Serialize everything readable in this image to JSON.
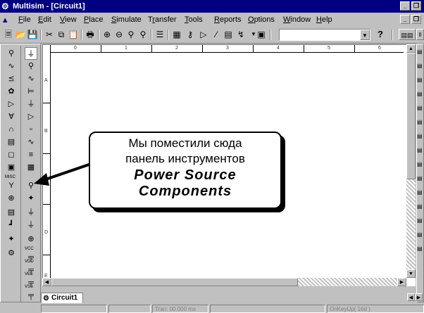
{
  "window": {
    "title": "Multisim - [Circuit1]",
    "app_icon": "multisim-icon",
    "controls": {
      "minimize": "_",
      "restore": "❐",
      "doc_minimize": "_",
      "doc_restore": "❐"
    }
  },
  "menu": {
    "items": [
      {
        "label": "File",
        "accel": "F"
      },
      {
        "label": "Edit",
        "accel": "E"
      },
      {
        "label": "View",
        "accel": "V"
      },
      {
        "label": "Place",
        "accel": "P"
      },
      {
        "label": "Simulate",
        "accel": "S"
      },
      {
        "label": "Transfer",
        "accel": "r"
      },
      {
        "label": "Tools",
        "accel": "T"
      },
      {
        "label": "Reports",
        "accel": "R"
      },
      {
        "label": "Options",
        "accel": "O"
      },
      {
        "label": "Window",
        "accel": "W"
      },
      {
        "label": "Help",
        "accel": "H"
      }
    ]
  },
  "toolbar": {
    "combo_value": "",
    "help_glyph": "?",
    "icons": [
      "new-icon",
      "open-icon",
      "save-icon",
      "cut-icon",
      "copy-icon",
      "paste-icon",
      "print-icon",
      "zoom-in-icon",
      "zoom-out-icon",
      "zoom-area-icon",
      "zoom-fit-icon",
      "hierarchy-icon",
      "spreadsheet-icon",
      "database-icon",
      "component-wizard-icon",
      "postprocessor-icon",
      "grapher-icon",
      "instrument-icon",
      "list-icon"
    ]
  },
  "ruler": {
    "columns": [
      "0",
      "1",
      "2",
      "3",
      "4",
      "5",
      "6"
    ],
    "rows": [
      "A",
      "B",
      "C",
      "D",
      "E"
    ]
  },
  "left_toolbar": {
    "col1": [
      "source-icon",
      "basic-icon",
      "diode-icon",
      "transistor-icon",
      "analog-icon",
      "ttl-icon",
      "cmos-icon",
      "mcu-icon",
      "misc-digital-icon",
      "mixed-icon",
      "indicator-icon",
      "misc-icon",
      "rf-icon",
      "electromech-icon",
      "ladder-icon",
      "place-bus-icon",
      "hierarchical-block-icon"
    ],
    "col2": [
      "ground-icon",
      "ac-source-icon",
      "dc-source-icon",
      "battery-icon",
      "vcc-icon",
      "vdd-icon",
      "clock-icon",
      "am-source-icon",
      "fm-source-icon",
      "controlled-source-icon",
      "digital-ground-icon",
      "three-phase-icon",
      "vee-icon",
      "vss-icon",
      "vcc-label-icon",
      "vdd-label-icon",
      "vss-label-icon"
    ],
    "labels": {
      "misc": "MISC",
      "vcc": "VCC",
      "vdd": "VDD",
      "vee": "VEE",
      "vss": "VSS"
    }
  },
  "tabs": [
    {
      "label": "Circuit1",
      "icon": "circuit-icon"
    }
  ],
  "statusbar": {
    "panels": [
      "",
      "",
      "Tran: 00.000 ms",
      "",
      "OnKeyUp( 16d )"
    ]
  },
  "callout": {
    "line1": "Мы поместили сюда",
    "line2": "панель инструментов",
    "line3": "Power Source",
    "line4": "Components"
  }
}
